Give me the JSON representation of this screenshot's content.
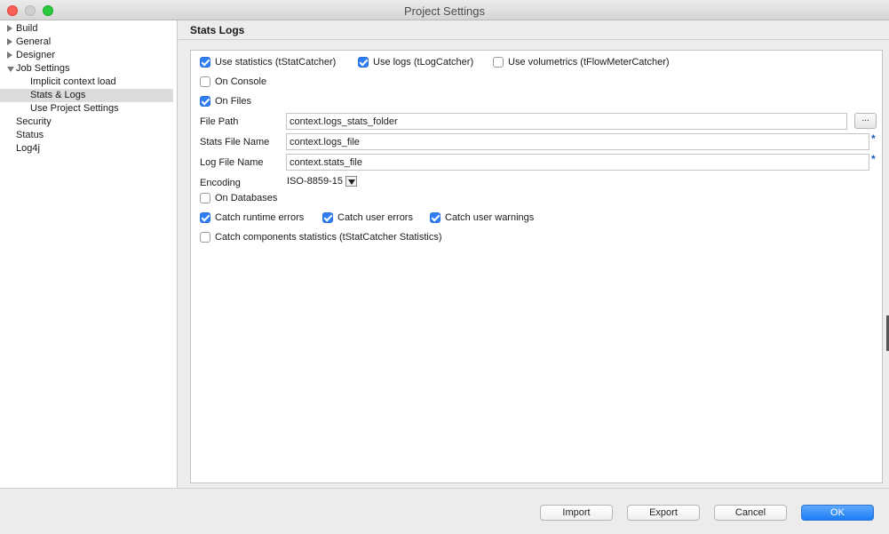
{
  "window": {
    "title": "Project Settings"
  },
  "sidebar": {
    "items": [
      {
        "label": "Build",
        "expander": "collapsed"
      },
      {
        "label": "General",
        "expander": "collapsed"
      },
      {
        "label": "Designer",
        "expander": "collapsed"
      },
      {
        "label": "Job Settings",
        "expander": "expanded"
      },
      {
        "label": "Implicit context load"
      },
      {
        "label": "Stats & Logs",
        "selected": true
      },
      {
        "label": "Use Project Settings"
      },
      {
        "label": "Security"
      },
      {
        "label": "Status"
      },
      {
        "label": "Log4j"
      }
    ]
  },
  "panel": {
    "title": "Stats  Logs",
    "options": {
      "use_statistics": {
        "label": "Use statistics (tStatCatcher)",
        "checked": true
      },
      "use_logs": {
        "label": "Use logs (tLogCatcher)",
        "checked": true
      },
      "use_volumetrics": {
        "label": "Use volumetrics (tFlowMeterCatcher)",
        "checked": false
      },
      "on_console": {
        "label": "On Console",
        "checked": false
      },
      "on_files": {
        "label": "On Files",
        "checked": true
      },
      "on_databases": {
        "label": "On Databases",
        "checked": false
      },
      "catch_runtime_errors": {
        "label": "Catch runtime errors",
        "checked": true
      },
      "catch_user_errors": {
        "label": "Catch user errors",
        "checked": true
      },
      "catch_user_warnings": {
        "label": "Catch user warnings",
        "checked": true
      },
      "catch_components_statistics": {
        "label": "Catch components statistics (tStatCatcher Statistics)",
        "checked": false
      }
    },
    "fields": {
      "file_path": {
        "label": "File Path",
        "value": "context.logs_stats_folder",
        "browse_label": "..."
      },
      "stats_file_name": {
        "label": "Stats File Name",
        "value": "context.logs_file",
        "required_mark": "*"
      },
      "log_file_name": {
        "label": "Log File Name",
        "value": "context.stats_file",
        "required_mark": "*"
      },
      "encoding": {
        "label": "Encoding",
        "value": "ISO-8859-15"
      }
    }
  },
  "footer": {
    "import_label": "Import",
    "export_label": "Export",
    "cancel_label": "Cancel",
    "ok_label": "OK"
  },
  "colors": {
    "accent": "#2f7ef5",
    "close": "#fd5f57",
    "maximize": "#2ac93f"
  }
}
